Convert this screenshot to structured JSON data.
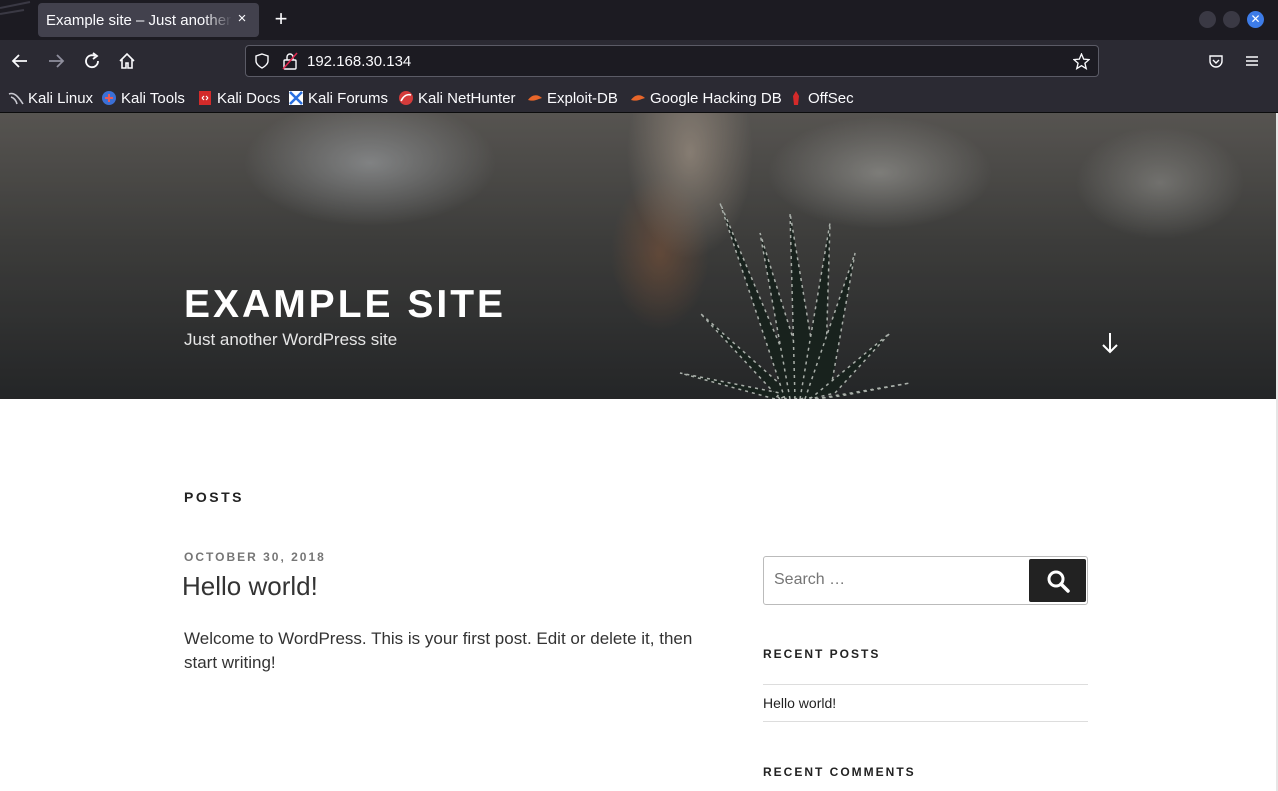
{
  "browser": {
    "tab_title": "Example site – Just another WordPress site",
    "tab_close": "×",
    "new_tab": "+",
    "url": "192.168.30.134",
    "bookmarks": [
      {
        "label": "Kali Linux"
      },
      {
        "label": "Kali Tools"
      },
      {
        "label": "Kali Docs"
      },
      {
        "label": "Kali Forums"
      },
      {
        "label": "Kali NetHunter"
      },
      {
        "label": "Exploit-DB"
      },
      {
        "label": "Google Hacking DB"
      },
      {
        "label": "OffSec"
      }
    ]
  },
  "site": {
    "title": "EXAMPLE SITE",
    "description": "Just another WordPress site"
  },
  "main": {
    "section_heading": "POSTS",
    "post": {
      "date": "OCTOBER 30, 2018",
      "title": "Hello world!",
      "excerpt": "Welcome to WordPress. This is your first post. Edit or delete it, then start writing!"
    }
  },
  "sidebar": {
    "search_placeholder": "Search …",
    "recent_posts_title": "RECENT POSTS",
    "recent_posts": [
      "Hello world!"
    ],
    "recent_comments_title": "RECENT COMMENTS"
  },
  "colors": {
    "chrome_dark": "#1c1b22",
    "chrome": "#2b2a33",
    "accent": "#3d7ce8",
    "text": "#333333",
    "meta": "#767676"
  }
}
